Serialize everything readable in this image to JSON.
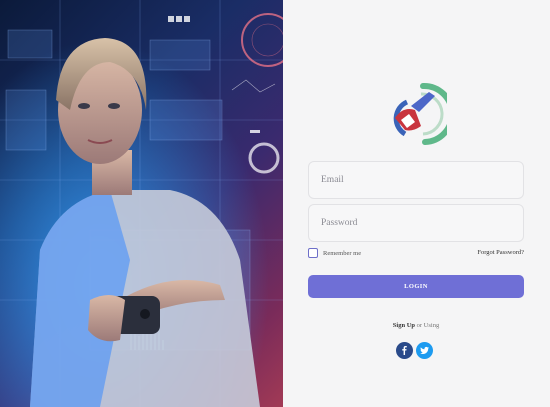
{
  "login": {
    "email_placeholder": "Email",
    "password_placeholder": "Password",
    "remember_label": "Remember me",
    "forgot_label": "Forgot Password?",
    "login_button": "LOGIN",
    "signup_label": "Sign Up",
    "signup_suffix": " or Using"
  },
  "social": {
    "facebook_icon": "facebook-icon",
    "twitter_icon": "twitter-icon"
  },
  "colors": {
    "accent": "#6f6fd6",
    "facebook": "#2a4a8a",
    "twitter": "#1d9bf0",
    "logo_green": "#5fb88a"
  }
}
